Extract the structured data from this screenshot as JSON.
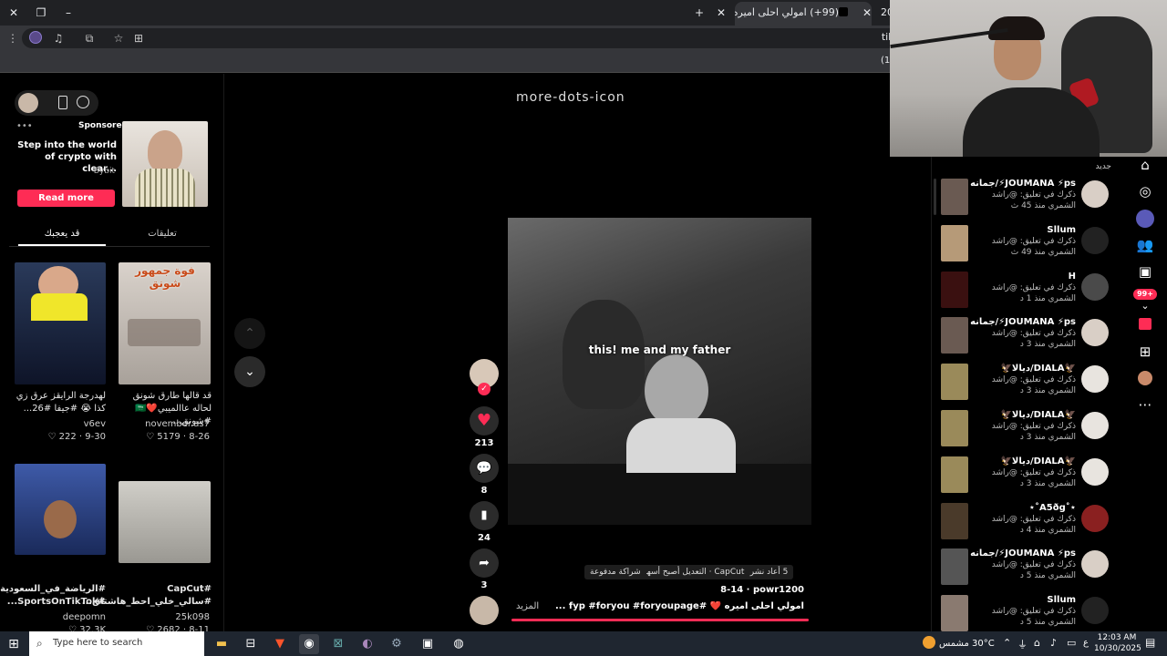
{
  "browser": {
    "tabs": [
      {
        "title": "(99+) امولي احلى اميره - لحظات",
        "active": true
      },
      {
        "title": "20",
        "active": false
      }
    ],
    "address": "tiktok",
    "bookmark_hint": "(13"
  },
  "sponsored": {
    "label": "Sponsored",
    "headline": "Step into the world of crypto with clear...",
    "brand": "Bybit",
    "cta": "Read more"
  },
  "left_tabs": {
    "liked": "قد يعجبك",
    "comments": "تعليقات"
  },
  "grid": [
    {
      "caption": "قد قالها طارق شونق لحاله عاالميبي❤️🇸🇦 #شونق...",
      "author": "november.as7",
      "likes": "5179",
      "date": "8-26",
      "overlay": "فوة جمهور شونق",
      "color": "#c9c3bd"
    },
    {
      "caption": "لهدرجة الرايقز عرق زي كذا 😭 #جيفا #26...",
      "author": "v6ev",
      "likes": "222",
      "date": "9-30",
      "overlay": "",
      "color": "#3a4a6a"
    },
    {
      "caption": "#CapCut #سالي_خلي_احط_هاشتاق...",
      "author": "25k098",
      "likes": "2682",
      "date": "8-11",
      "overlay": "",
      "color": "#b8b6b0"
    },
    {
      "caption": "#الرياضة_في_السعودية #SportsOnTikTok...",
      "author": "deepomn",
      "likes": "32.3K",
      "date": "",
      "overlay": "",
      "color": "#2f4f8f"
    }
  ],
  "video": {
    "overlay_text": "this! me and my father",
    "author": "powr1200",
    "date": "8-14",
    "caption": "امولي احلى اميره ❤️ #fyp #foryou #foryoupage ...",
    "more": "المزيد",
    "tags": [
      {
        "label": "5 أعاد نشره"
      },
      {
        "label": "CapCut · التعديل أصبح أسهل"
      },
      {
        "label": "شراكة مدفوعة"
      }
    ],
    "likes": "213",
    "comments": "8",
    "saves": "24",
    "shares": "3",
    "more_icon": "more-dots-icon"
  },
  "notifications": {
    "header": "جديد",
    "items": [
      {
        "name": "JOUMANA ⚡ps⚡/جمانه",
        "line1": "ذكرك في تعليق: @راشد",
        "line2": "الشمري منذ 45 ث",
        "thumb": "#6a5a52",
        "avatar": "#d9cfc6"
      },
      {
        "name": "Sllum",
        "line1": "ذكرك في تعليق: @راشد",
        "line2": "الشمري منذ 49 ث",
        "thumb": "#b69a78",
        "avatar": "#222222"
      },
      {
        "name": "H",
        "line1": "ذكرك في تعليق: @راشد",
        "line2": "الشمري منذ 1 د",
        "thumb": "#3a1010",
        "avatar": "#4a4a4a"
      },
      {
        "name": "JOUMANA ⚡ps⚡/جمانه",
        "line1": "ذكرك في تعليق: @راشد",
        "line2": "الشمري منذ 3 د",
        "thumb": "#6a5a52",
        "avatar": "#d9cfc6"
      },
      {
        "name": "🦅DIALA/ديالا🦅",
        "line1": "ذكرك في تعليق: @راشد",
        "line2": "الشمري منذ 3 د",
        "thumb": "#9a8a5a",
        "avatar": "#e8e4df"
      },
      {
        "name": "🦅DIALA/ديالا🦅",
        "line1": "ذكرك في تعليق: @راشد",
        "line2": "الشمري منذ 3 د",
        "thumb": "#9a8a5a",
        "avatar": "#e8e4df"
      },
      {
        "name": "🦅DIALA/ديالا🦅",
        "line1": "ذكرك في تعليق: @راشد",
        "line2": "الشمري منذ 3 د",
        "thumb": "#9a8a5a",
        "avatar": "#e8e4df"
      },
      {
        "name": "⋆˚A5ðg˚⋆",
        "line1": "ذكرك في تعليق: @راشد",
        "line2": "الشمري منذ 4 د",
        "thumb": "#4a3a2a",
        "avatar": "#8a2020"
      },
      {
        "name": "JOUMANA ⚡ps⚡/جمانه",
        "line1": "ذكرك في تعليق: @راشد",
        "line2": "الشمري منذ 5 د",
        "thumb": "#555555",
        "avatar": "#d9cfc6"
      },
      {
        "name": "Sllum",
        "line1": "ذكرك في تعليق: @راشد",
        "line2": "الشمري منذ 5 د",
        "thumb": "#8a7a70",
        "avatar": "#222222"
      }
    ]
  },
  "rail": {
    "badge": "99+"
  },
  "taskbar": {
    "search_placeholder": "Type here to search",
    "weather": "30°C مشمس",
    "time": "12:03 AM",
    "date": "10/30/2025",
    "lang": "ع"
  },
  "colors": {
    "accent": "#fe2c55",
    "chrome_dark": "#202124",
    "chrome_tab": "#35363a"
  }
}
